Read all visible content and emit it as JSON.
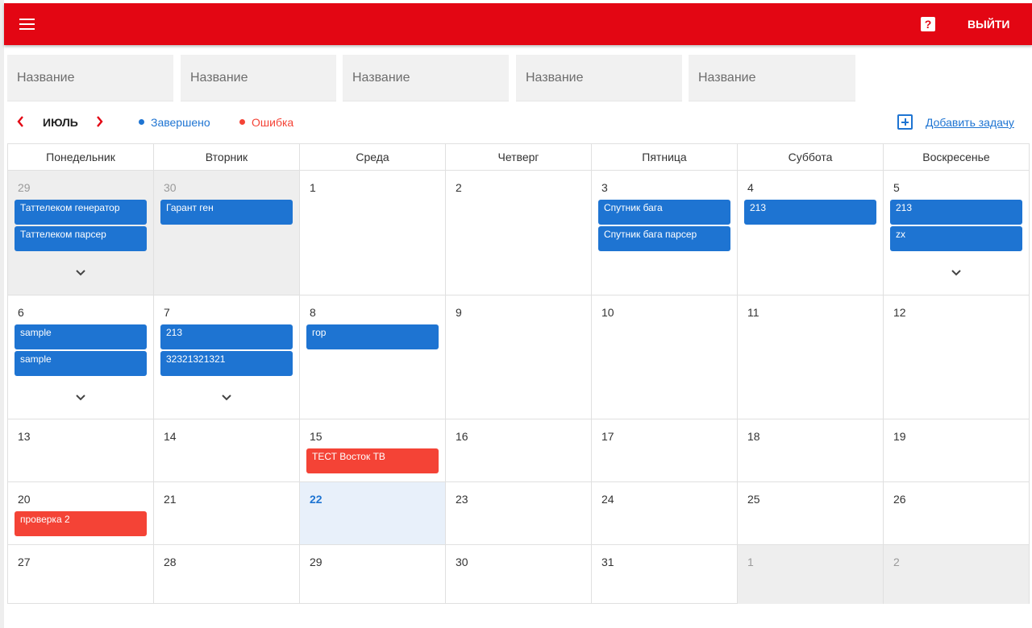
{
  "topbar": {
    "help_label": "?",
    "logout_label": "ВЫЙТИ",
    "color": "#e30613"
  },
  "filters": [
    {
      "placeholder": "Название"
    },
    {
      "placeholder": "Название"
    },
    {
      "placeholder": "Название"
    },
    {
      "placeholder": "Название"
    },
    {
      "placeholder": "Название"
    }
  ],
  "nav": {
    "prev": "‹",
    "next": "›",
    "month": "ИЮЛЬ"
  },
  "legend": {
    "done": {
      "label": "Завершено",
      "color": "#1e74d2"
    },
    "error": {
      "label": "Ошибка",
      "color": "#f44336"
    }
  },
  "add_task": {
    "label": "Добавить задачу",
    "icon": "plus-square-icon"
  },
  "weekdays": [
    "Понедельник",
    "Вторник",
    "Среда",
    "Четверг",
    "Пятница",
    "Суббота",
    "Воскресенье"
  ],
  "weeks": [
    {
      "days": [
        {
          "num": "29",
          "other": true,
          "tasks": [
            {
              "title": "Таттелеком генератор",
              "status": "blue"
            },
            {
              "title": "Таттелеком парсер",
              "status": "blue"
            }
          ],
          "expand": true
        },
        {
          "num": "30",
          "other": true,
          "tasks": [
            {
              "title": "Гарант ген",
              "status": "blue"
            }
          ]
        },
        {
          "num": "1",
          "tasks": []
        },
        {
          "num": "2",
          "tasks": []
        },
        {
          "num": "3",
          "tasks": [
            {
              "title": "Спутник бага",
              "status": "blue"
            },
            {
              "title": "Спутник бага парсер",
              "status": "blue"
            }
          ]
        },
        {
          "num": "4",
          "tasks": [
            {
              "title": "213",
              "status": "blue"
            }
          ]
        },
        {
          "num": "5",
          "tasks": [
            {
              "title": "213",
              "status": "blue"
            },
            {
              "title": "zx",
              "status": "blue"
            }
          ],
          "expand": true
        }
      ]
    },
    {
      "days": [
        {
          "num": "6",
          "tasks": [
            {
              "title": "sample",
              "status": "blue"
            },
            {
              "title": "sample",
              "status": "blue"
            }
          ],
          "expand": true
        },
        {
          "num": "7",
          "tasks": [
            {
              "title": "213",
              "status": "blue"
            },
            {
              "title": "32321321321",
              "status": "blue"
            }
          ],
          "expand": true
        },
        {
          "num": "8",
          "tasks": [
            {
              "title": "гор",
              "status": "blue"
            }
          ]
        },
        {
          "num": "9",
          "tasks": []
        },
        {
          "num": "10",
          "tasks": []
        },
        {
          "num": "11",
          "tasks": []
        },
        {
          "num": "12",
          "tasks": []
        }
      ]
    },
    {
      "days": [
        {
          "num": "13",
          "tasks": []
        },
        {
          "num": "14",
          "tasks": []
        },
        {
          "num": "15",
          "tasks": [
            {
              "title": "ТЕСТ Восток ТВ",
              "status": "red"
            }
          ]
        },
        {
          "num": "16",
          "tasks": []
        },
        {
          "num": "17",
          "tasks": []
        },
        {
          "num": "18",
          "tasks": []
        },
        {
          "num": "19",
          "tasks": []
        }
      ]
    },
    {
      "days": [
        {
          "num": "20",
          "tasks": [
            {
              "title": "проверка 2",
              "status": "red"
            }
          ]
        },
        {
          "num": "21",
          "tasks": []
        },
        {
          "num": "22",
          "today": true,
          "tasks": []
        },
        {
          "num": "23",
          "tasks": []
        },
        {
          "num": "24",
          "tasks": []
        },
        {
          "num": "25",
          "tasks": []
        },
        {
          "num": "26",
          "tasks": []
        }
      ]
    },
    {
      "days": [
        {
          "num": "27",
          "tasks": []
        },
        {
          "num": "28",
          "tasks": []
        },
        {
          "num": "29",
          "tasks": []
        },
        {
          "num": "30",
          "tasks": []
        },
        {
          "num": "31",
          "tasks": []
        },
        {
          "num": "1",
          "other": true,
          "tasks": []
        },
        {
          "num": "2",
          "other": true,
          "tasks": []
        }
      ]
    }
  ]
}
